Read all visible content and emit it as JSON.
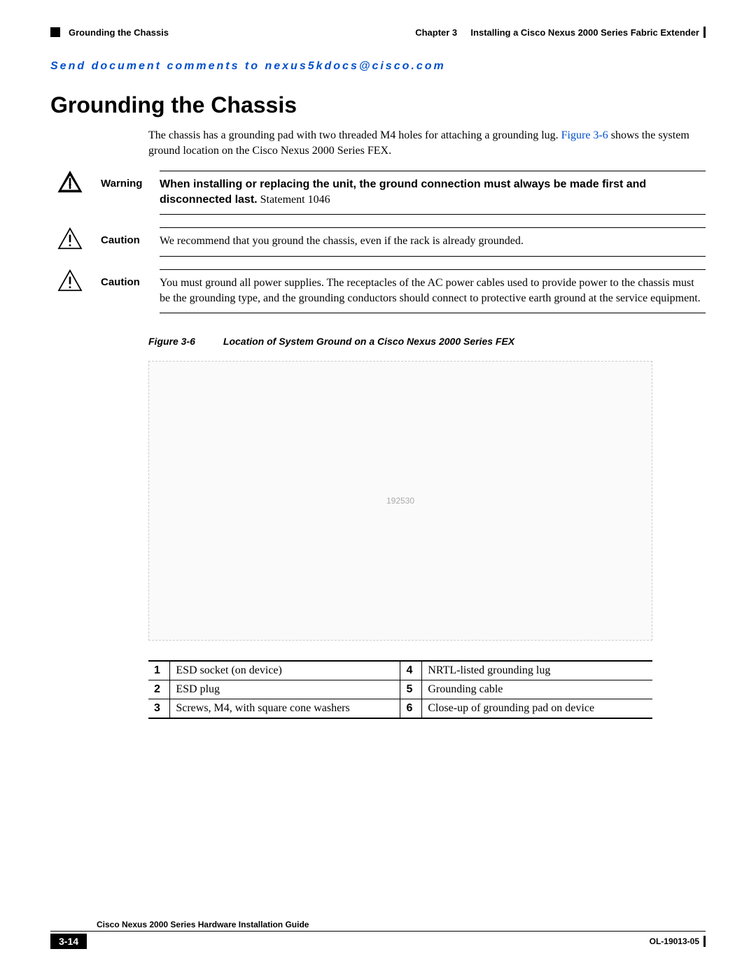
{
  "header": {
    "section_title": "Grounding the Chassis",
    "chapter_label": "Chapter 3",
    "chapter_title": "Installing a Cisco Nexus 2000 Series Fabric Extender"
  },
  "comment_line": "Send document comments to nexus5kdocs@cisco.com",
  "h1": "Grounding the Chassis",
  "intro": {
    "text_a": "The chassis has a grounding pad with two threaded M4 holes for attaching a grounding lug. ",
    "link": "Figure 3-6",
    "text_b": " shows the system ground location on the Cisco Nexus 2000 Series FEX."
  },
  "warning": {
    "label": "Warning",
    "bold_text": "When installing or replacing the unit, the ground connection must always be made first and disconnected last.",
    "statement": " Statement 1046"
  },
  "caution1": {
    "label": "Caution",
    "text": "We recommend that you ground the chassis, even if the rack is already grounded."
  },
  "caution2": {
    "label": "Caution",
    "text": "You must ground all power supplies. The receptacles of the AC power cables used to provide power to the chassis must be the grounding type, and the grounding conductors should connect to protective earth ground at the service equipment."
  },
  "figure": {
    "label": "Figure 3-6",
    "caption": "Location of System Ground on a Cisco Nexus 2000 Series FEX",
    "image_id": "192530"
  },
  "callouts": [
    {
      "n": "1",
      "desc": "ESD socket (on device)"
    },
    {
      "n": "2",
      "desc": "ESD plug"
    },
    {
      "n": "3",
      "desc": "Screws, M4, with square cone washers"
    },
    {
      "n": "4",
      "desc": "NRTL-listed grounding lug"
    },
    {
      "n": "5",
      "desc": "Grounding cable"
    },
    {
      "n": "6",
      "desc": "Close-up of grounding pad on device"
    }
  ],
  "footer": {
    "guide_title": "Cisco Nexus 2000 Series Hardware Installation Guide",
    "page_number": "3-14",
    "doc_id": "OL-19013-05"
  }
}
